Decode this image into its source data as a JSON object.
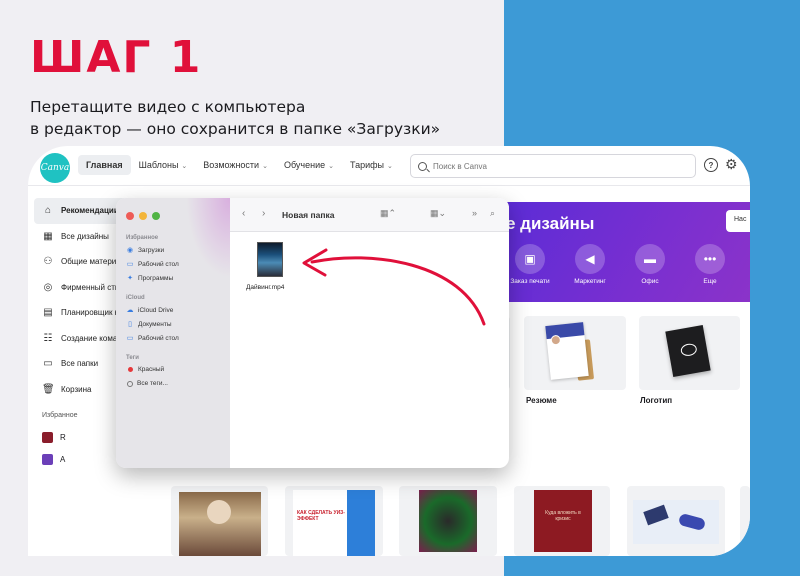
{
  "step_title": "ШАГ 1",
  "subtitle": {
    "line1": "Перетащите видео с компьютера",
    "line2": "в редактор —  оно сохранится в папке «Загрузки»"
  },
  "colors": {
    "accent_red": "#e0103a",
    "band_blue": "#3d9ad6",
    "canva_teal": "#1fc2c2",
    "banner_purple": "#6a2fd4",
    "arrow_red": "#e0103a"
  },
  "canva": {
    "logo": "Canva",
    "nav": [
      {
        "label": "Главная",
        "active": true
      },
      {
        "label": "Шаблоны",
        "dropdown": true
      },
      {
        "label": "Возможности",
        "dropdown": true
      },
      {
        "label": "Обучение",
        "dropdown": true
      },
      {
        "label": "Тарифы",
        "dropdown": true
      }
    ],
    "search": {
      "placeholder": "Поиск в Canva"
    },
    "icons": {
      "help": "help-icon",
      "settings": "gear-icon"
    },
    "sidebar": {
      "items": [
        {
          "label": "Рекомендации",
          "icon": "home-icon",
          "active": true
        },
        {
          "label": "Все дизайны",
          "icon": "grid-icon"
        },
        {
          "label": "Общие материалы",
          "icon": "people-icon"
        },
        {
          "label": "Фирменный стиль",
          "icon": "brand-icon"
        },
        {
          "label": "Планировщик контента",
          "icon": "calendar-icon"
        },
        {
          "label": "Создание команды",
          "icon": "team-icon"
        },
        {
          "label": "Все папки",
          "icon": "folder-icon"
        },
        {
          "label": "Корзина",
          "icon": "trash-icon"
        }
      ],
      "favorites_heading": "Избранное",
      "favorites": [
        {
          "label": "R",
          "color": "#8a1d2b"
        },
        {
          "label": "A",
          "color": "#6b3fb8"
        }
      ]
    },
    "banner": {
      "title": "е дизайны",
      "button": "Нас",
      "categories": [
        {
          "label": "Заказ печати",
          "icon": "print-icon"
        },
        {
          "label": "Маркетинг",
          "icon": "megaphone-icon"
        },
        {
          "label": "Офис",
          "icon": "briefcase-icon"
        },
        {
          "label": "Еще",
          "icon": "more-icon"
        }
      ]
    },
    "templates": [
      {
        "label": "Резюме"
      },
      {
        "label": "Логотип"
      }
    ],
    "thumbnails": {
      "thumb2_text": "КАК СДЕЛАТЬ УИЗ-ЭФФЕКТ",
      "thumb4_text": "Куда вложить в кризис"
    }
  },
  "finder": {
    "title": "Новая папка",
    "sections": [
      {
        "heading": "Избранное",
        "items": [
          {
            "label": "Загрузки",
            "icon": "download-icon"
          },
          {
            "label": "Рабочий стол",
            "icon": "desktop-icon"
          },
          {
            "label": "Программы",
            "icon": "apps-icon"
          }
        ]
      },
      {
        "heading": "iCloud",
        "items": [
          {
            "label": "iCloud Drive",
            "icon": "cloud-icon"
          },
          {
            "label": "Документы",
            "icon": "document-icon"
          },
          {
            "label": "Рабочий стол",
            "icon": "desktop-icon"
          }
        ]
      },
      {
        "heading": "Теги",
        "items": [
          {
            "label": "Красный",
            "icon": "red-tag-icon"
          },
          {
            "label": "Все теги...",
            "icon": "tags-icon"
          }
        ]
      }
    ],
    "file": {
      "name": "Дайвинг.mp4"
    }
  }
}
